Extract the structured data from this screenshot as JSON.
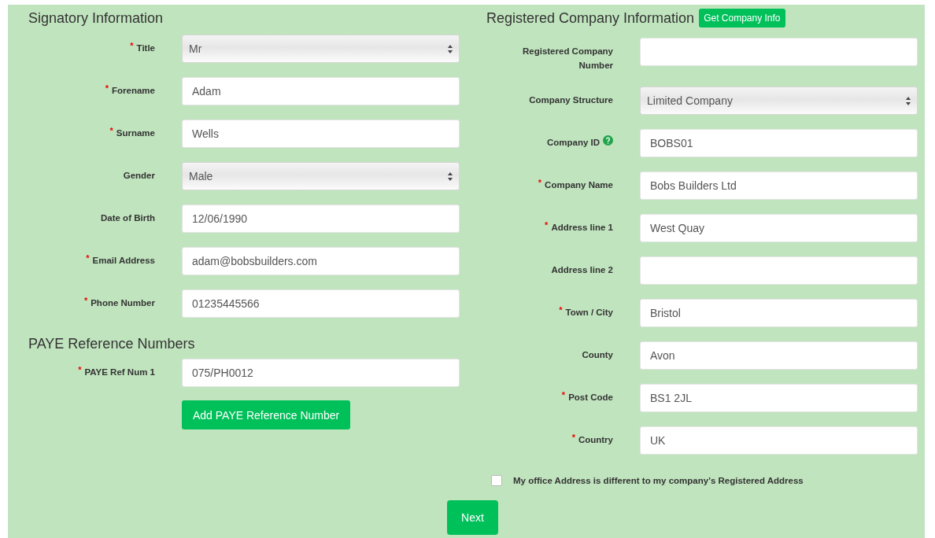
{
  "signatory": {
    "heading": "Signatory Information",
    "fields": [
      {
        "label": "Title",
        "kind": "select",
        "value": "Mr",
        "required_mark": "*"
      },
      {
        "label": "Forename",
        "kind": "text",
        "value": "Adam",
        "required_mark": "*"
      },
      {
        "label": "Surname",
        "kind": "text",
        "value": "Wells",
        "required_mark": "*"
      },
      {
        "label": "Gender",
        "kind": "select",
        "value": "Male"
      },
      {
        "label": "Date of Birth",
        "kind": "text",
        "value": "12/06/1990"
      },
      {
        "label": "Email Address",
        "kind": "text",
        "value": "adam@bobsbuilders.com",
        "required_mark": "*"
      },
      {
        "label": "Phone Number",
        "kind": "text",
        "value": "01235445566",
        "required_mark": "*"
      }
    ]
  },
  "paye": {
    "heading": "PAYE Reference Numbers",
    "fields": [
      {
        "label": "PAYE Ref Num 1",
        "kind": "text",
        "value": "075/PH0012",
        "required_mark": "*"
      }
    ],
    "add_button": "Add PAYE Reference Number"
  },
  "company": {
    "heading": "Registered Company Information",
    "lookup_button": "Get Company Info",
    "fields": [
      {
        "label": "Registered Company Number",
        "kind": "text",
        "help": false
      },
      {
        "label": "Company Structure",
        "kind": "select",
        "value": "Limited Company",
        "help": false
      },
      {
        "label": "Company ID",
        "kind": "text",
        "value": "BOBS01",
        "help": true
      },
      {
        "label": "Company Name",
        "kind": "text",
        "value": "Bobs Builders Ltd",
        "required_mark": "*",
        "help": false
      },
      {
        "label": "Address line 1",
        "kind": "text",
        "value": "West Quay",
        "required_mark": "*",
        "help": false
      },
      {
        "label": "Address line 2",
        "kind": "text",
        "help": false
      },
      {
        "label": "Town / City",
        "kind": "text",
        "value": "Bristol",
        "required_mark": "*",
        "help": false
      },
      {
        "label": "County",
        "kind": "text",
        "value": "Avon",
        "help": false
      },
      {
        "label": "Post Code",
        "kind": "text",
        "value": "BS1 2JL",
        "required_mark": "*",
        "help": false
      },
      {
        "label": "Country",
        "kind": "text",
        "value": "UK",
        "required_mark": "*",
        "help": false
      }
    ],
    "office_checkbox": {
      "label": "My office Address is different to my company's Registered Address",
      "checked": false
    }
  },
  "next_button": "Next"
}
